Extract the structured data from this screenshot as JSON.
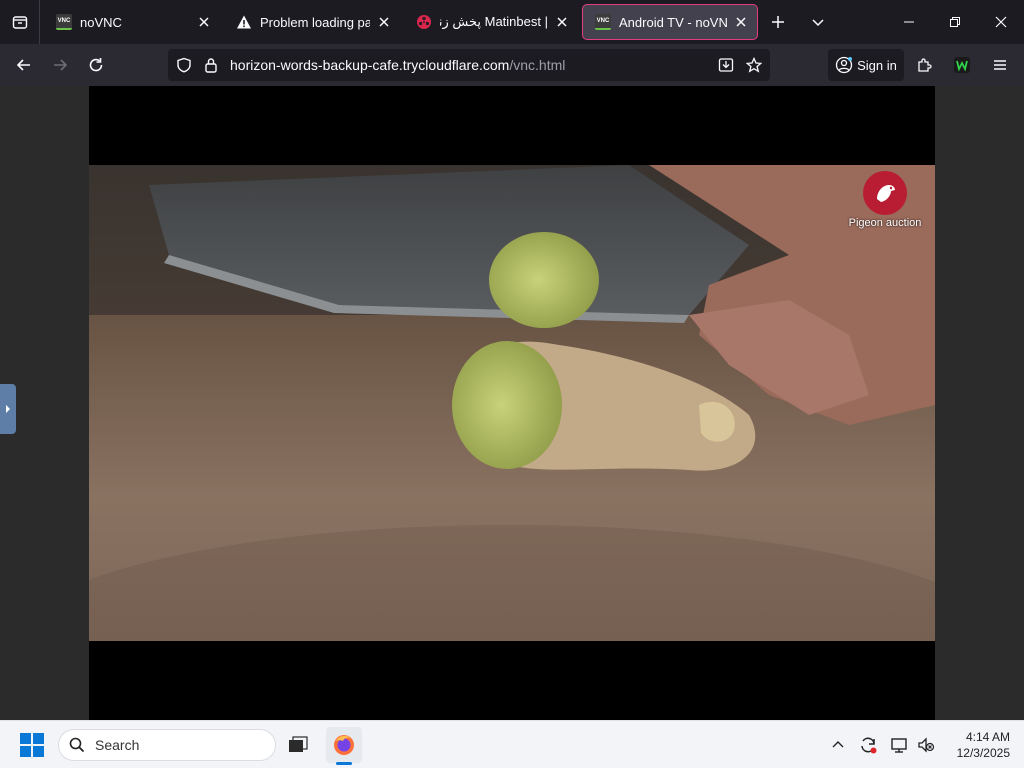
{
  "browser": {
    "tabs": [
      {
        "label": "noVNC",
        "favicon": "vnc-favicon"
      },
      {
        "label": "Problem loading page",
        "favicon": "warning-icon"
      },
      {
        "label": "| Matinbest پخش زنده",
        "favicon": "film-reel-icon"
      },
      {
        "label": "Android TV - noVNC",
        "favicon": "vnc-favicon",
        "active": true
      }
    ],
    "url": {
      "host": "horizon-words-backup-cafe.trycloudflare.com",
      "path": "/vnc.html"
    },
    "signin_label": "Sign in",
    "accent_color": "#e33d7f"
  },
  "video": {
    "channel_name": "Pigeon auction",
    "channel_color": "#b81d34"
  },
  "taskbar": {
    "search_placeholder": "Search",
    "time": "4:14 AM",
    "date": "12/3/2025"
  }
}
